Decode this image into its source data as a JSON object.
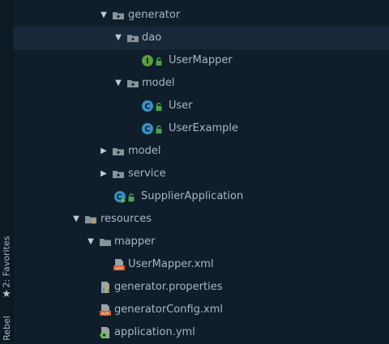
{
  "left_toolbar": {
    "favorites_label": "2: Favorites",
    "rebel_label": "Rebel"
  },
  "tree": {
    "items": [
      {
        "label": "generator",
        "icon": "package-folder-icon",
        "expanded": true
      },
      {
        "label": "dao",
        "icon": "package-folder-icon",
        "expanded": true,
        "selected": true
      },
      {
        "label": "UserMapper",
        "icon": "interface-icon"
      },
      {
        "label": "model",
        "icon": "package-folder-icon",
        "expanded": true
      },
      {
        "label": "User",
        "icon": "class-icon"
      },
      {
        "label": "UserExample",
        "icon": "class-icon"
      },
      {
        "label": "model",
        "icon": "package-folder-icon",
        "expanded": false
      },
      {
        "label": "service",
        "icon": "package-folder-icon",
        "expanded": false
      },
      {
        "label": "SupplierApplication",
        "icon": "spring-boot-class-icon"
      },
      {
        "label": "resources",
        "icon": "resources-folder-icon",
        "expanded": true
      },
      {
        "label": "mapper",
        "icon": "folder-icon",
        "expanded": true
      },
      {
        "label": "UserMapper.xml",
        "icon": "xml-file-icon"
      },
      {
        "label": "generator.properties",
        "icon": "properties-file-icon"
      },
      {
        "label": "generatorConfig.xml",
        "icon": "xml-file-icon"
      },
      {
        "label": "application.yml",
        "icon": "yml-file-icon"
      }
    ]
  },
  "colors": {
    "background": "#0f1e2a",
    "selected_row": "#17283a",
    "text": "#a9b7c6",
    "class_icon": "#3592c4",
    "interface_icon": "#5c9e3c",
    "lock": "#4aa34a",
    "xml_icon": "#d3602a"
  }
}
